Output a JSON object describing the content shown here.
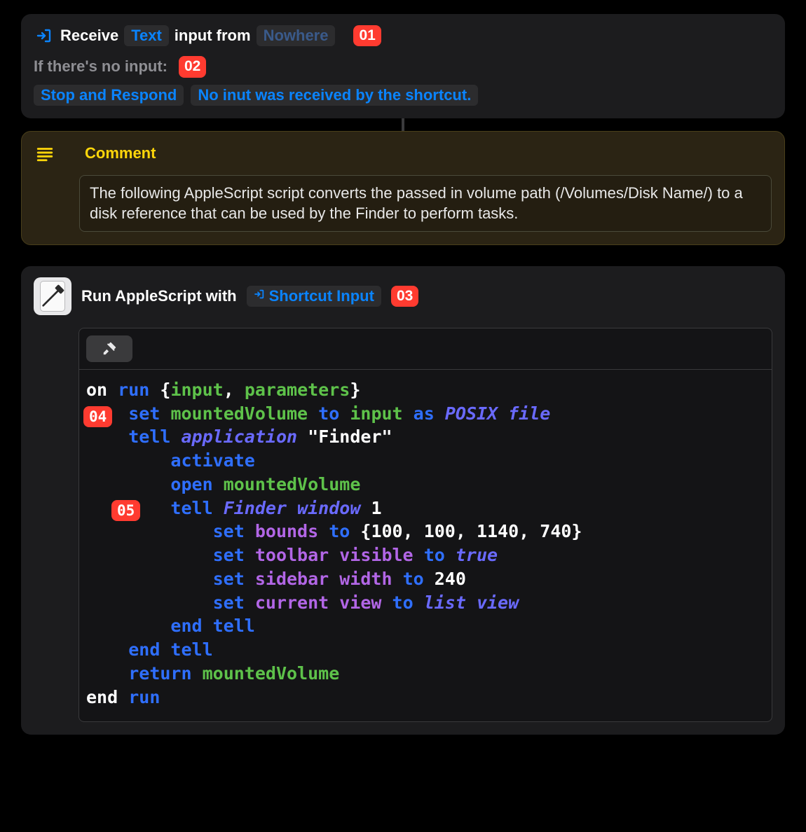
{
  "annotations": {
    "a01": "01",
    "a02": "02",
    "a03": "03",
    "a04": "04",
    "a05": "05"
  },
  "receive": {
    "line_prefix": "Receive",
    "type_token": "Text",
    "middle": "input from",
    "source_token": "Nowhere",
    "no_input_label": "If there's no input:",
    "fallback_action": "Stop and Respond",
    "fallback_message": "No inut was received by the shortcut."
  },
  "comment": {
    "title": "Comment",
    "body": "The following AppleScript script converts the passed in volume path (/Volumes/Disk Name/) to a disk reference that can be used by the Finder to perform tasks."
  },
  "applescript": {
    "title": "Run AppleScript with",
    "input_token": "Shortcut Input",
    "code": {
      "line1_on": "on",
      "line1_run": "run",
      "line1_brace_open": "{",
      "line1_input": "input",
      "line1_comma": ", ",
      "line1_params": "parameters",
      "line1_brace_close": "}",
      "line2_set": "set",
      "line2_var": "mountedVolume",
      "line2_to": "to",
      "line2_input": "input",
      "line2_as": "as",
      "line2_posix": "POSIX file",
      "line3_tell": "tell",
      "line3_app": "application",
      "line3_finder": "\"Finder\"",
      "line4_activate": "activate",
      "line5_open": "open",
      "line5_var": "mountedVolume",
      "line6_tell": "tell",
      "line6_fw": "Finder window",
      "line6_one": "1",
      "line7_set": "set",
      "line7_bounds": "bounds",
      "line7_to": "to",
      "line7_vals": "{100, 100, 1140, 740}",
      "line8_set": "set",
      "line8_tb": "toolbar visible",
      "line8_to": "to",
      "line8_true": "true",
      "line9_set": "set",
      "line9_sw": "sidebar width",
      "line9_to": "to",
      "line9_val": "240",
      "line10_set": "set",
      "line10_cv": "current view",
      "line10_to": "to",
      "line10_lv": "list view",
      "line11_end": "end tell",
      "line12_end": "end tell",
      "line13_return": "return",
      "line13_var": "mountedVolume",
      "line14_end": "end",
      "line14_run": "run"
    }
  }
}
